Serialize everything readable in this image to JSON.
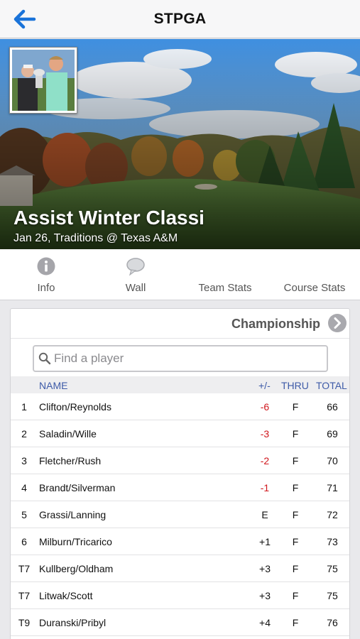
{
  "nav": {
    "title": "STPGA"
  },
  "event": {
    "title": "Assist Winter Classi",
    "subtitle": "Jan 26, Traditions @ Texas A&M"
  },
  "tabs": [
    {
      "label": "Info",
      "icon": "info-icon"
    },
    {
      "label": "Wall",
      "icon": "speech-bubble-icon"
    },
    {
      "label": "Team Stats"
    },
    {
      "label": "Course Stats"
    }
  ],
  "leaderboard": {
    "round": "Championship",
    "search_placeholder": "Find a player",
    "headers": {
      "name": "NAME",
      "plus_minus": "+/-",
      "thru": "THRU",
      "total": "TOTAL"
    },
    "rows": [
      {
        "pos": "1",
        "name": "Clifton/Reynolds",
        "pm": "-6",
        "thru": "F",
        "total": "66"
      },
      {
        "pos": "2",
        "name": "Saladin/Wille",
        "pm": "-3",
        "thru": "F",
        "total": "69"
      },
      {
        "pos": "3",
        "name": "Fletcher/Rush",
        "pm": "-2",
        "thru": "F",
        "total": "70"
      },
      {
        "pos": "4",
        "name": "Brandt/Silverman",
        "pm": "-1",
        "thru": "F",
        "total": "71"
      },
      {
        "pos": "5",
        "name": "Grassi/Lanning",
        "pm": "E",
        "thru": "F",
        "total": "72"
      },
      {
        "pos": "6",
        "name": "Milburn/Tricarico",
        "pm": "+1",
        "thru": "F",
        "total": "73"
      },
      {
        "pos": "T7",
        "name": "Kullberg/Oldham",
        "pm": "+3",
        "thru": "F",
        "total": "75"
      },
      {
        "pos": "T7",
        "name": "Litwak/Scott",
        "pm": "+3",
        "thru": "F",
        "total": "75"
      },
      {
        "pos": "T9",
        "name": "Duranski/Pribyl",
        "pm": "+4",
        "thru": "F",
        "total": "76"
      }
    ]
  },
  "colors": {
    "accent": "#1a73d9",
    "header_text": "#3e5ba8",
    "under_par": "#d0161c"
  }
}
